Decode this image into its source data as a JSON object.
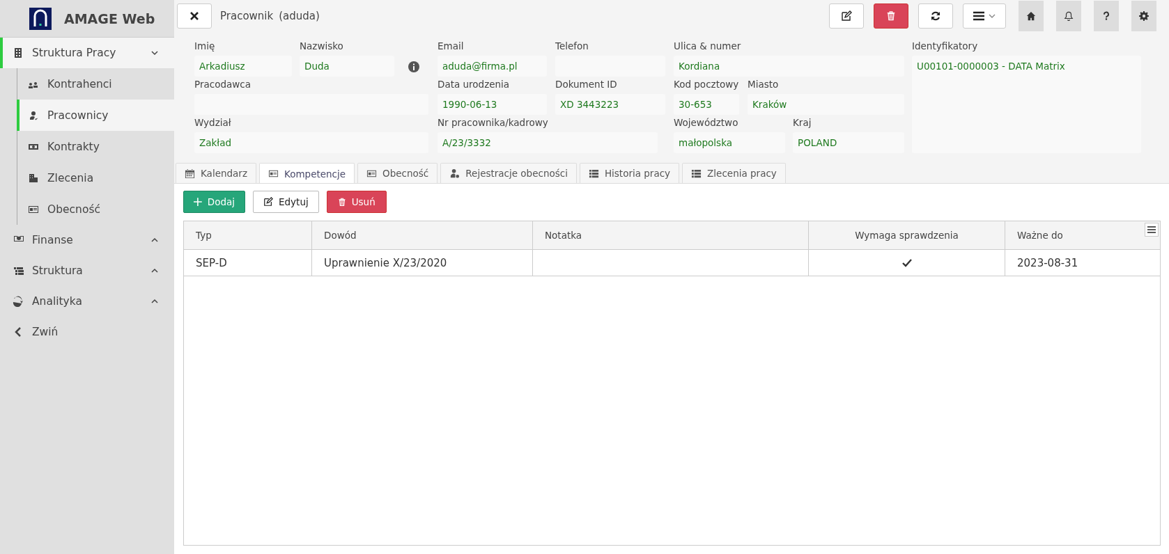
{
  "app": {
    "title": "AMAGE Web"
  },
  "sidebar": {
    "items": [
      {
        "label": "Struktura Pracy",
        "expanded": true,
        "selected": true,
        "children": [
          {
            "label": "Kontrahenci",
            "selected": false
          },
          {
            "label": "Pracownicy",
            "selected": true
          },
          {
            "label": "Kontrakty",
            "selected": false
          },
          {
            "label": "Zlecenia",
            "selected": false
          },
          {
            "label": "Obecność",
            "selected": false
          }
        ]
      },
      {
        "label": "Finanse",
        "expanded": false,
        "selected": false
      },
      {
        "label": "Struktura",
        "expanded": false,
        "selected": false
      },
      {
        "label": "Analityka",
        "expanded": false,
        "selected": false
      }
    ],
    "collapse": "Zwiń"
  },
  "header": {
    "title": "Pracownik",
    "subtitle": "(aduda)"
  },
  "form": {
    "fields": [
      {
        "label": "Imię",
        "value": "Arkadiusz"
      },
      {
        "label": "Nazwisko",
        "value": "Duda"
      },
      {
        "label": "Email",
        "value": "aduda@firma.pl"
      },
      {
        "label": "Telefon"
      },
      {
        "label": "Ulica & numer",
        "value": "Kordiana"
      },
      {
        "label": "Identyfikatory",
        "value": "U00101-0000003 - DATA Matrix"
      },
      {
        "label": "Pracodawca"
      },
      {
        "label": "Data urodzenia",
        "value": "1990-06-13"
      },
      {
        "label": "Dokument ID",
        "value": "XD 3443223"
      },
      {
        "label": "Kod pocztowy",
        "value": "30-653"
      },
      {
        "label": "Miasto",
        "value": "Kraków"
      },
      {
        "label": "Wydział",
        "value": "Zakład"
      },
      {
        "label": "Nr pracownika/kadrowy",
        "value": "A/23/3332"
      },
      {
        "label": "Województwo",
        "value": "małopolska"
      },
      {
        "label": "Kraj",
        "value": "POLAND"
      }
    ]
  },
  "tabs": [
    {
      "label": "Kalendarz",
      "selected": false
    },
    {
      "label": "Kompetencje",
      "selected": true
    },
    {
      "label": "Obecność",
      "selected": false
    },
    {
      "label": "Rejestracje obecności",
      "selected": false
    },
    {
      "label": "Historia pracy",
      "selected": false
    },
    {
      "label": "Zlecenia pracy",
      "selected": false
    }
  ],
  "actions": [
    {
      "label": "Dodaj",
      "kind": "add"
    },
    {
      "label": "Edytuj",
      "kind": "edit"
    },
    {
      "label": "Usuń",
      "kind": "delete"
    }
  ],
  "table": {
    "columns": [
      "Typ",
      "Dowód",
      "Notatka",
      "Wymaga sprawdzenia",
      "Ważne do"
    ],
    "rows": [
      {
        "typ": "SEP-D",
        "dowod": "Uprawnienie X/23/2020",
        "wymaga_sprawdzenia": true,
        "wazne_do": "2023-08-31"
      }
    ]
  }
}
